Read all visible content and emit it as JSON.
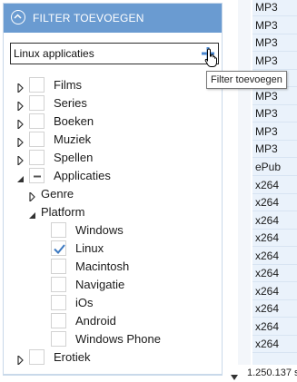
{
  "panel": {
    "title": "FILTER TOEVOEGEN",
    "header_color": "#6a9bd1",
    "collapse_icon": "chevron-up-circle-icon"
  },
  "search": {
    "value": "Linux applicaties",
    "add_icon": "plus-icon",
    "tooltip": "Filter toevoegen"
  },
  "tree": [
    {
      "label": "Films",
      "level": 0,
      "expander": "collapsed",
      "state": "unchecked"
    },
    {
      "label": "Series",
      "level": 0,
      "expander": "collapsed",
      "state": "unchecked"
    },
    {
      "label": "Boeken",
      "level": 0,
      "expander": "collapsed",
      "state": "unchecked"
    },
    {
      "label": "Muziek",
      "level": 0,
      "expander": "collapsed",
      "state": "unchecked"
    },
    {
      "label": "Spellen",
      "level": 0,
      "expander": "collapsed",
      "state": "unchecked"
    },
    {
      "label": "Applicaties",
      "level": 0,
      "expander": "expanded",
      "state": "indeterminate"
    },
    {
      "label": "Genre",
      "level": 1,
      "expander": "collapsed",
      "state": "none"
    },
    {
      "label": "Platform",
      "level": 1,
      "expander": "expanded",
      "state": "none"
    },
    {
      "label": "Windows",
      "level": 2,
      "expander": "none",
      "state": "unchecked"
    },
    {
      "label": "Linux",
      "level": 2,
      "expander": "none",
      "state": "checked"
    },
    {
      "label": "Macintosh",
      "level": 2,
      "expander": "none",
      "state": "unchecked"
    },
    {
      "label": "Navigatie",
      "level": 2,
      "expander": "none",
      "state": "unchecked"
    },
    {
      "label": "iOs",
      "level": 2,
      "expander": "none",
      "state": "unchecked"
    },
    {
      "label": "Android",
      "level": 2,
      "expander": "none",
      "state": "unchecked"
    },
    {
      "label": "Windows Phone",
      "level": 2,
      "expander": "none",
      "state": "unchecked"
    },
    {
      "label": "Erotiek",
      "level": 0,
      "expander": "collapsed",
      "state": "unchecked"
    }
  ],
  "right_list": [
    "MP3",
    "MP3",
    "MP3",
    "MP3",
    "MP3",
    "MP3",
    "MP3",
    "MP3",
    "MP3",
    "ePub",
    "x264",
    "x264",
    "x264",
    "x264",
    "x264",
    "x264",
    "x264",
    "x264",
    "x264",
    "x264"
  ],
  "status": {
    "text": "1.250.137 s",
    "arrow_icon": "down-arrow-icon"
  },
  "colors": {
    "accent": "#6a9bd1",
    "check": "#3d79c1",
    "list_bg": "#eaf2fb"
  }
}
